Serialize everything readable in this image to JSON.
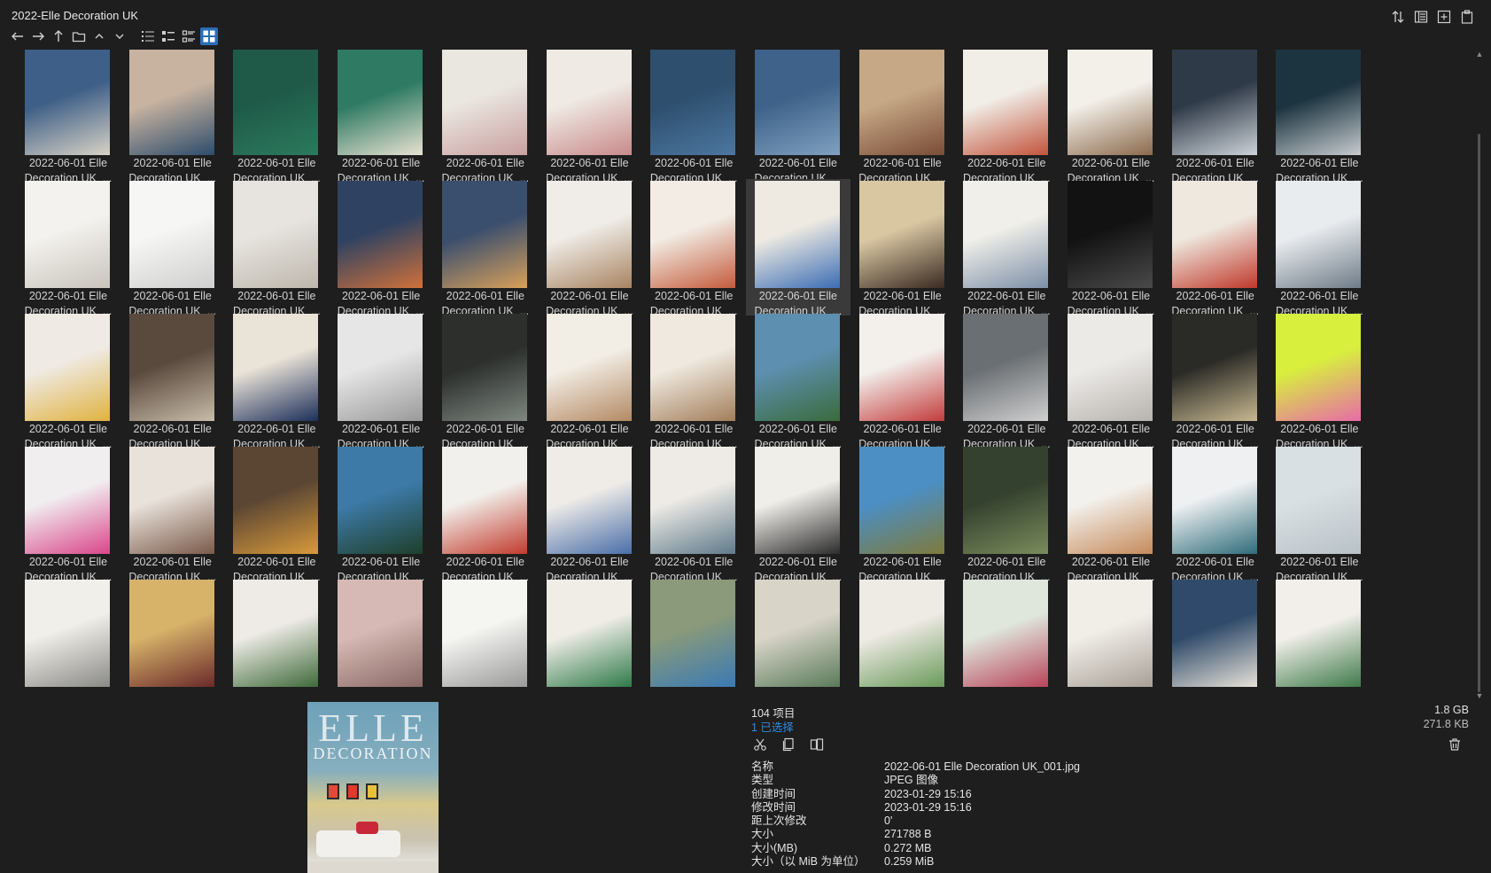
{
  "window": {
    "title": "2022-Elle Decoration UK"
  },
  "toolbar": {
    "icons": [
      "back-icon",
      "forward-icon",
      "up-icon",
      "folder-icon",
      "chevron-up-icon",
      "chevron-down-icon",
      "details-view-icon",
      "list-view-icon",
      "tiles-view-icon",
      "thumbnail-view-icon"
    ],
    "right_icons": [
      "sort-icon",
      "panel-icon",
      "new-icon",
      "copy-icon"
    ]
  },
  "files": {
    "caption_line1": "2022-06-01 Elle",
    "caption_line2": "Decoration UK_...",
    "selected_index": 20,
    "thumbs": [
      [
        "#3e5f87",
        "#d8d2c6"
      ],
      [
        "#c8b3a0",
        "#2d4c6b"
      ],
      [
        "#1f5a48",
        "#2b7a5d"
      ],
      [
        "#2e7a63",
        "#e9e2d2"
      ],
      [
        "#eae6e0",
        "#c9a0a0"
      ],
      [
        "#efeae4",
        "#c88a8a"
      ],
      [
        "#2e4f6e",
        "#4c77a0"
      ],
      [
        "#3e6289",
        "#7fa0c0"
      ],
      [
        "#c6a886",
        "#7a4c36"
      ],
      [
        "#f1eee8",
        "#c2543c"
      ],
      [
        "#f3f0ea",
        "#8b6a4c"
      ],
      [
        "#2f3a48",
        "#cdd3d9"
      ],
      [
        "#1c3440",
        "#c7ccd0"
      ],
      [
        "#f4f2ee",
        "#c8c4bc"
      ],
      [
        "#f6f6f4",
        "#cfcfcf"
      ],
      [
        "#e7e4df",
        "#bdb6ac"
      ],
      [
        "#2f4262",
        "#d0713a"
      ],
      [
        "#3a4e6e",
        "#d8a05a"
      ],
      [
        "#f0ede8",
        "#a88462"
      ],
      [
        "#f2ece4",
        "#c45b3c"
      ],
      [
        "#eeeae2",
        "#3b6db5"
      ],
      [
        "#d9c7a2",
        "#3a2a22"
      ],
      [
        "#f0efe9",
        "#7d8fa8"
      ],
      [
        "#121212",
        "#4a4a4a"
      ],
      [
        "#efe8df",
        "#c0392b"
      ],
      [
        "#e9ecef",
        "#6f7c88"
      ],
      [
        "#efeae3",
        "#e0b240"
      ],
      [
        "#5a4a3e",
        "#c9bca9"
      ],
      [
        "#eae3d7",
        "#1d2f5a"
      ],
      [
        "#e6e6e6",
        "#9a9a9a"
      ],
      [
        "#2c2f2c",
        "#7e8780"
      ],
      [
        "#f2ede5",
        "#b48a64"
      ],
      [
        "#efe9e0",
        "#a37e5a"
      ],
      [
        "#5d8fb0",
        "#3a6b3c"
      ],
      [
        "#f3f0ec",
        "#c23d3d"
      ],
      [
        "#6a6f73",
        "#cfcfcf"
      ],
      [
        "#eceae7",
        "#b7b3ae"
      ],
      [
        "#2a2a26",
        "#c8b890"
      ],
      [
        "#d8ef3e",
        "#e76ba8"
      ],
      [
        "#f1eef0",
        "#d9468a"
      ],
      [
        "#e9e2db",
        "#7a5a4a"
      ],
      [
        "#5b4634",
        "#d89a3a"
      ],
      [
        "#3d7aa8",
        "#1e3f2a"
      ],
      [
        "#f2f0ec",
        "#c23b2d"
      ],
      [
        "#efece8",
        "#4a6ea8"
      ],
      [
        "#eeebe6",
        "#5f7a8a"
      ],
      [
        "#f0eee9",
        "#2c2c2c"
      ],
      [
        "#4b8fc4",
        "#7f7a3c"
      ],
      [
        "#35412f",
        "#7a8c5c"
      ],
      [
        "#f3f1ed",
        "#c58a5a"
      ],
      [
        "#eef0f2",
        "#2f6c7a"
      ],
      [
        "#d9e0e4",
        "#b8c1c6"
      ],
      [
        "#f1efea",
        "#8a8a86"
      ],
      [
        "#d7b36a",
        "#6a2a2a"
      ],
      [
        "#eeebe6",
        "#3f6a3a"
      ],
      [
        "#d6b9b4",
        "#8a6a66"
      ],
      [
        "#f5f5f2",
        "#9a9a9a"
      ],
      [
        "#f0ede7",
        "#2f7a4a"
      ],
      [
        "#8a9a7a",
        "#3a7ab4"
      ],
      [
        "#d8d4c8",
        "#5a7a5a"
      ],
      [
        "#eeeae4",
        "#6a9a5a"
      ],
      [
        "#dfe6dc",
        "#b8445a"
      ],
      [
        "#f1eee8",
        "#a8a097"
      ],
      [
        "#2f4a6a",
        "#e7e2d8"
      ],
      [
        "#f2efea",
        "#3f7a4a"
      ]
    ]
  },
  "status": {
    "item_count": "104 项目",
    "selected_count": "1 已选择",
    "total_size": "1.8 GB",
    "selected_size": "271.8 KB"
  },
  "preview": {
    "logo": "ELLE",
    "subtitle": "DECORATION"
  },
  "properties": [
    {
      "key": "名称",
      "value": "2022-06-01 Elle Decoration UK_001.jpg"
    },
    {
      "key": "类型",
      "value": "JPEG 图像"
    },
    {
      "key": "创建时间",
      "value": "2023-01-29  15:16"
    },
    {
      "key": "修改时间",
      "value": "2023-01-29  15:16"
    },
    {
      "key": "距上次修改",
      "value": "0'"
    },
    {
      "key": "大小",
      "value": "271788 B"
    },
    {
      "key": "大小(MB)",
      "value": "0.272 MB"
    },
    {
      "key": "大小（以 MiB 为单位）",
      "value": "0.259 MiB"
    }
  ]
}
